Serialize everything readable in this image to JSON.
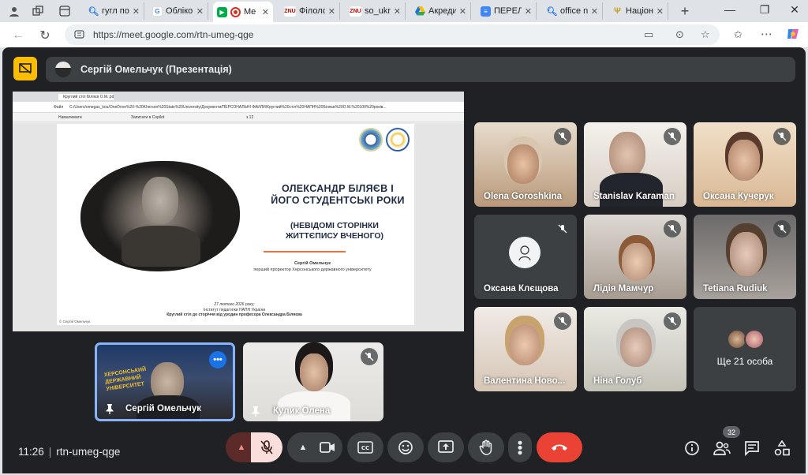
{
  "browser": {
    "tabs": [
      {
        "title": "гугл пош"
      },
      {
        "title": "Обліков"
      },
      {
        "title": "Me"
      },
      {
        "title": "Філолог"
      },
      {
        "title": "so_ukr_"
      },
      {
        "title": "Акреди"
      },
      {
        "title": "ПЕРЕЛІК"
      },
      {
        "title": "office n"
      },
      {
        "title": "Націона"
      }
    ],
    "url": "https://meet.google.com/rtn-umeg-qge"
  },
  "meet": {
    "presenter_label": "Сергій Омельчук (Презентація)",
    "slide": {
      "title": "ОЛЕКСАНДР БІЛЯЄВ І ЙОГО СТУДЕНТСЬКІ РОКИ",
      "subtitle": "(НЕВІДОМІ СТОРІНКИ ЖИТТЄПИСУ ВЧЕНОГО)",
      "author_name": "Сергій Омельчук",
      "author_role": "перший проректор Херсонського державного університету",
      "date": "27 лютого 2026 року;",
      "institute": "Інститут педагогіки НАПН України",
      "event": "Круглий стіл до сторіччя від уродин професора Олександра Біляєва",
      "copyright": "© Сергій Омельчук",
      "pdf_tab": "Круглий стіл Біляєв О.М..pdf",
      "pdf_path": "C:/Users/omegas_kou/OneDrive%20-%20Kherson%20State%20University/Документи/ПЕРСОНАЛЬНІ ФАЙЛИ/Круглий%20стіл%20НАПН%20Біляєв%20О.М.%20100%20років...",
      "pdf_file_label": "Файл",
      "pdf_draw_label": "Намалювати",
      "pdf_copilot_label": "Запитати в Copilot",
      "pdf_page": "з 12"
    },
    "participants": [
      {
        "name": "Olena Goroshkina"
      },
      {
        "name": "Stanislav Karaman"
      },
      {
        "name": "Оксана Кучерук"
      },
      {
        "name": "Оксана Клєщова"
      },
      {
        "name": "Лідія Мамчур"
      },
      {
        "name": "Tetiana Rudiuk"
      },
      {
        "name": "Валентина Ново..."
      },
      {
        "name": "Ніна Голуб"
      }
    ],
    "more_people": "Ще 21 особа",
    "self_tiles": [
      {
        "name": "Сергій Омельчук",
        "banner": "ХЕРСОНСЬКИЙ ДЕРЖАВНИЙ УНІВЕРСИТЕТ"
      },
      {
        "name": "Кулик Олена"
      }
    ],
    "time": "11:26",
    "meeting_code": "rtn-umeg-qge",
    "participant_count": "32"
  },
  "colors": {
    "meet_bg": "#202124",
    "tile_bg": "#3c4043",
    "end_call": "#ea4335",
    "accent_blue": "#1a73e8",
    "present_badge": "#fbbc04"
  }
}
